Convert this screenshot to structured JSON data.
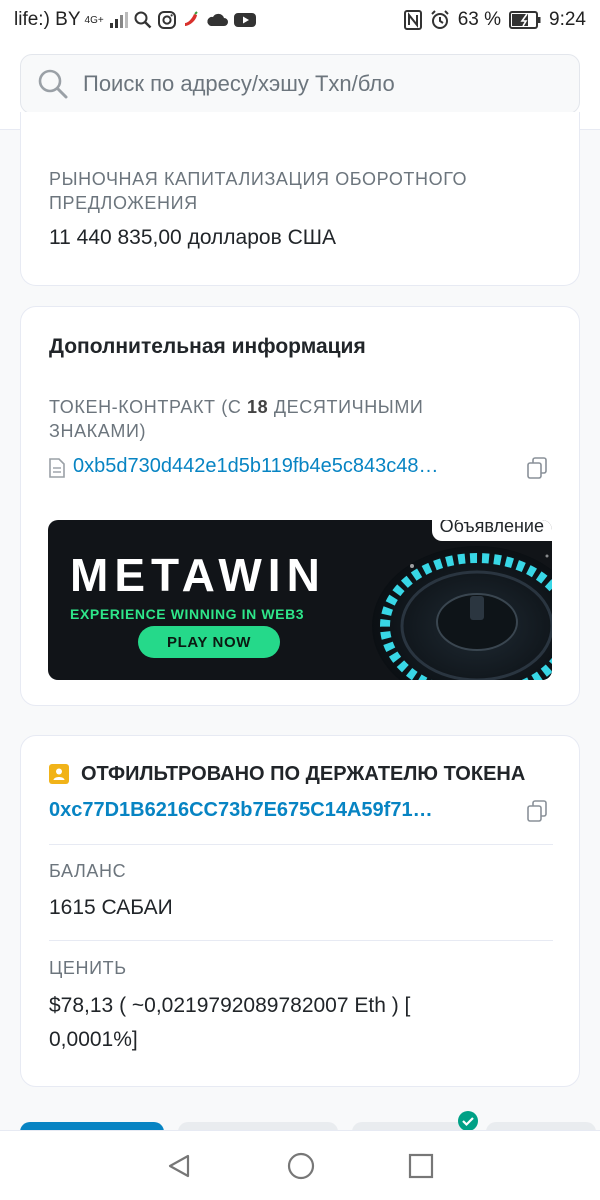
{
  "status_bar": {
    "carrier": "life:) BY",
    "network": "4G+",
    "battery_percent": "63 %",
    "time": "9:24"
  },
  "search": {
    "placeholder": "Поиск по адресу/хэшу Txn/бло"
  },
  "market_cap": {
    "label": "РЫНОЧНАЯ КАПИТАЛИЗАЦИЯ ОБОРОТНОГО ПРЕДЛОЖЕНИЯ",
    "value": "11 440 835,00 долларов США"
  },
  "more_info": {
    "title": "Дополнительная информация",
    "contract_label_prefix": "ТОКЕН-КОНТРАКТ (С ",
    "contract_label_decimals": "18",
    "contract_label_suffix": " ДЕСЯТИЧНЫМИ ЗНАКАМИ)",
    "contract_address": "0xb5d730d442e1d5b119fb4e5c843c48…",
    "ad": {
      "label": "Объявление",
      "brand": "METAWIN",
      "tagline": "EXPERIENCE WINNING IN WEB3",
      "cta": "PLAY NOW"
    }
  },
  "holder_filter": {
    "title": "ОТФИЛЬТРОВАНО ПО ДЕРЖАТЕЛЮ ТОКЕНА",
    "holder_address": "0xc77D1B6216CC73b7E675C14A59f71…",
    "balance_label": "БАЛАНС",
    "balance_value": "1615 САБАИ",
    "value_label": "ЦЕНИТЬ",
    "value_line1": "$78,13 ( ~0,0219792089782007 Eth ) [",
    "value_line2": "0,0001%]"
  },
  "colors": {
    "link": "#0784c3",
    "accent_yellow": "#f1b319",
    "ad_green": "#25d98a"
  }
}
